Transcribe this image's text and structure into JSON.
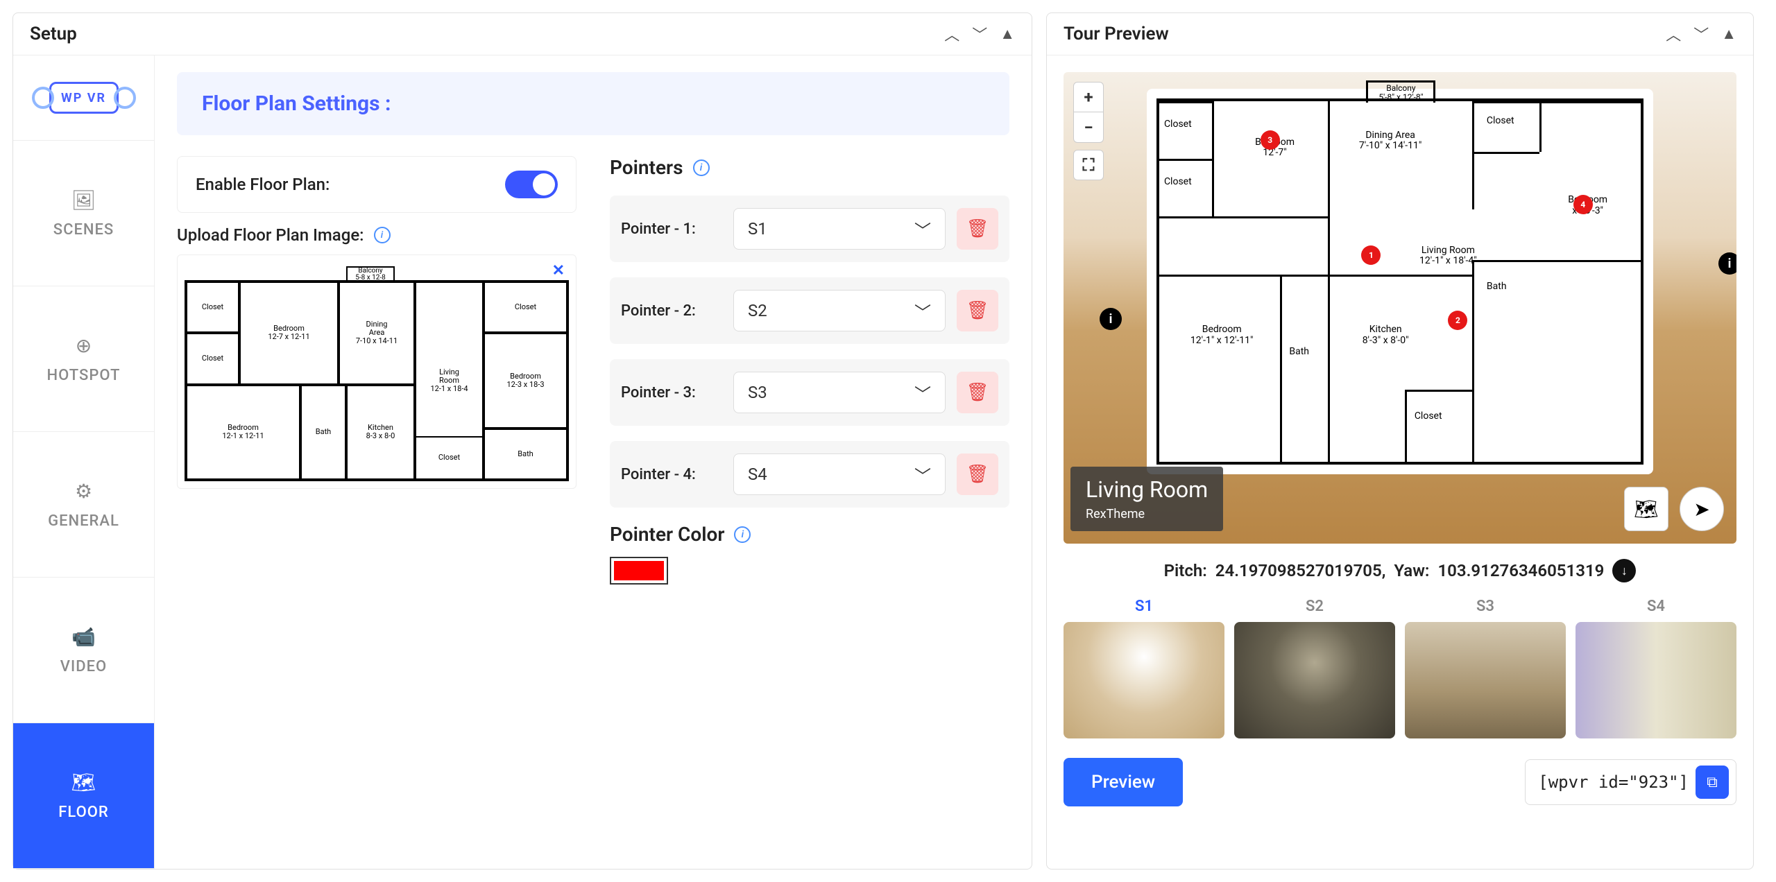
{
  "setup": {
    "title": "Setup",
    "settings_header": "Floor Plan Settings :",
    "nav": {
      "scenes": "SCENES",
      "hotspot": "HOTSPOT",
      "general": "GENERAL",
      "video": "VIDEO",
      "floor": "FLOOR"
    },
    "logo_text": "WP VR",
    "enable_label": "Enable Floor Plan:",
    "enable_value": true,
    "upload_label": "Upload Floor Plan Image:",
    "pointers_title": "Pointers",
    "pointers": [
      {
        "label": "Pointer - 1:",
        "value": "S1"
      },
      {
        "label": "Pointer - 2:",
        "value": "S2"
      },
      {
        "label": "Pointer - 3:",
        "value": "S3"
      },
      {
        "label": "Pointer - 4:",
        "value": "S4"
      }
    ],
    "pointer_color_label": "Pointer Color",
    "pointer_color": "#ff0000"
  },
  "preview": {
    "title": "Tour Preview",
    "scene_title": "Living Room",
    "scene_author": "RexTheme",
    "pitch_label": "Pitch:",
    "pitch_value": "24.197098527019705,",
    "yaw_label": "Yaw:",
    "yaw_value": "103.91276346051319",
    "floorplan": {
      "balcony": "Balcony",
      "balcony_dim": "5'-8\" x 12'-8\"",
      "closet": "Closet",
      "bedroom_tl": "Bedroom",
      "bedroom_tl_dim": "12'-7\"",
      "dining": "Dining Area",
      "dining_dim": "7'-10\" x 14'-11\"",
      "living": "Living Room",
      "living_dim": "12'-1\" x 18'-4\"",
      "bedroom_bl": "Bedroom",
      "bedroom_bl_dim": "12'-1\" x 12'-11\"",
      "bath": "Bath",
      "kitchen": "Kitchen",
      "kitchen_dim": "8'-3\" x 8'-0\"",
      "bedroom_r": "Bedroom",
      "bedroom_r_dim": "x 18'-3\""
    },
    "pointers": [
      "3",
      "1",
      "2",
      "4"
    ],
    "scenes": [
      {
        "id": "S1",
        "active": true
      },
      {
        "id": "S2",
        "active": false
      },
      {
        "id": "S3",
        "active": false
      },
      {
        "id": "S4",
        "active": false
      }
    ],
    "preview_btn": "Preview",
    "shortcode": "[wpvr id=\"923\"]"
  }
}
